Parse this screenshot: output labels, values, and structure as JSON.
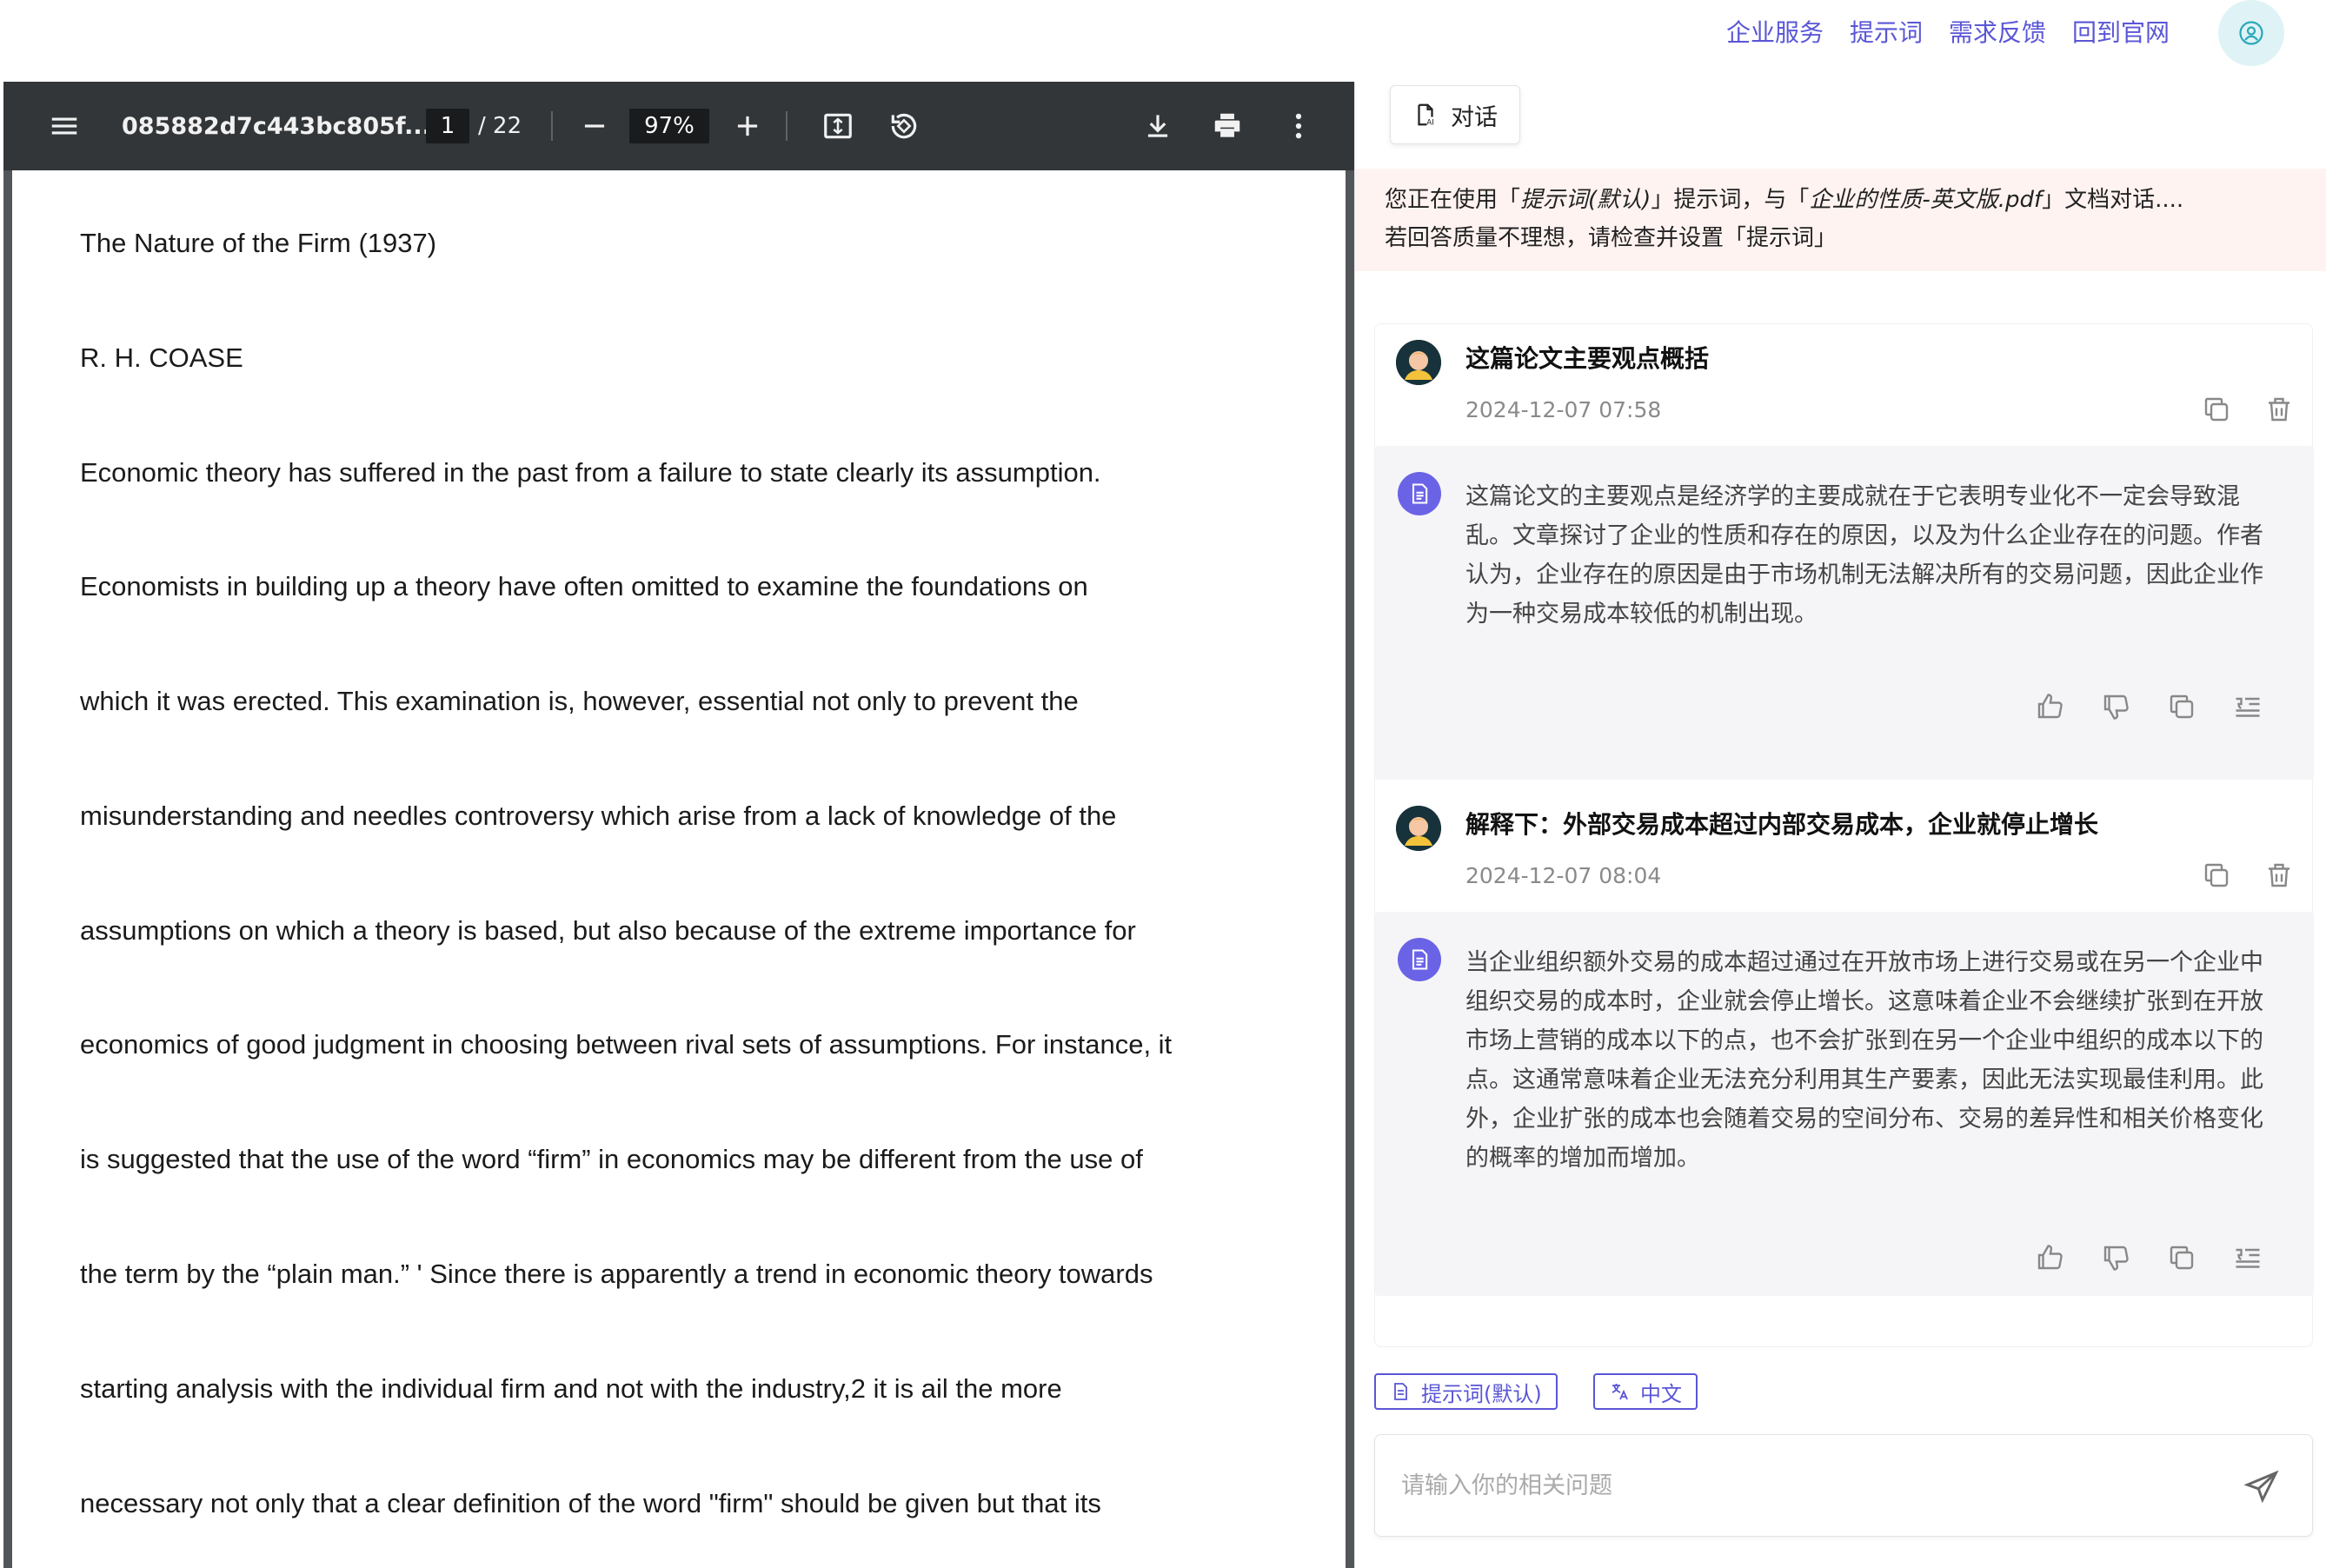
{
  "topnav": {
    "links": [
      "企业服务",
      "提示词",
      "需求反馈",
      "回到官网"
    ]
  },
  "pdf": {
    "filename": "085882d7c443bc805f...",
    "page_current": "1",
    "page_total": "/ 22",
    "zoom": "97%",
    "lines": [
      "The Nature of the Firm (1937)",
      "R. H. COASE",
      "Economic theory has suffered in the past from a failure to state clearly its assumption.",
      "Economists in building up a theory have often omitted to examine the foundations on",
      "which it was erected. This examination is, however, essential not only to prevent the",
      "misunderstanding and needles controversy which arise from a lack of knowledge of the",
      "assumptions on which a theory is based, but also because of the extreme importance for",
      "economics of good judgment in choosing between rival sets of assumptions. For instance, it",
      "is suggested that the use of the word  “firm”  in economics may be different from the use of",
      "the term by the  “plain man.” ' Since there is apparently a trend in economic theory towards",
      "starting analysis with the individual firm and not with the industry,2 it is ail the more",
      "necessary not only that a clear definition of the word \"firm\" should be given but that its"
    ]
  },
  "chat": {
    "tab_label": "对话",
    "notice": {
      "line1_prefix": "您正在使用「",
      "line1_prompt": "提示词(默认)",
      "line1_mid": "」提示词，与「",
      "line1_doc": "企业的性质-英文版.pdf",
      "line1_suffix": "」文档对话....",
      "line2": "若回答质量不理想，请检查并设置「提示词」"
    },
    "messages": [
      {
        "question": "这篇论文主要观点概括",
        "time": "2024-12-07 07:58",
        "answer": "这篇论文的主要观点是经济学的主要成就在于它表明专业化不一定会导致混乱。文章探讨了企业的性质和存在的原因，以及为什么企业存在的问题。作者认为，企业存在的原因是由于市场机制无法解决所有的交易问题，因此企业作为一种交易成本较低的机制出现。"
      },
      {
        "question": "解释下：外部交易成本超过内部交易成本，企业就停止增长",
        "time": "2024-12-07 08:04",
        "answer": "当企业组织额外交易的成本超过通过在开放市场上进行交易或在另一个企业中组织交易的成本时，企业就会停止增长。这意味着企业不会继续扩张到在开放市场上营销的成本以下的点，也不会扩张到在另一个企业中组织的成本以下的点。这通常意味着企业无法充分利用其生产要素，因此无法实现最佳利用。此外，企业扩张的成本也会随着交易的空间分布、交易的差异性和相关价格变化的概率的增加而增加。"
      }
    ],
    "chips": [
      "提示词(默认)",
      "中文"
    ],
    "input_placeholder": "请输入你的相关问题"
  },
  "colors": {
    "accent": "#5a56d6",
    "toolbar_bg": "#323639",
    "notice_bg": "#fff3f1"
  }
}
